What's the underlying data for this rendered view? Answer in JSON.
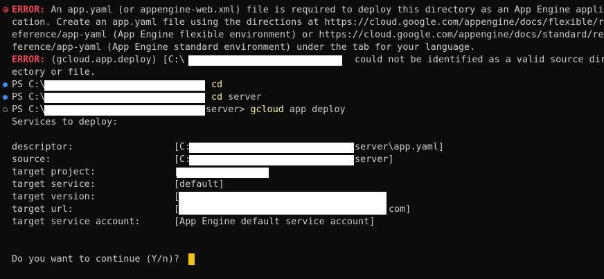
{
  "error1": {
    "label": "ERROR:",
    "lines": [
      " An app.yaml (or appengine-web.xml) file is required to deploy this directory as an App Engine appli",
      "cation. Create an app.yaml file using the directions at https://cloud.google.com/appengine/docs/flexible/r",
      "eference/app-yaml (App Engine flexible environment) or https://cloud.google.com/appengine/docs/standard/re",
      "ference/app-yaml (App Engine standard environment) under the tab for your language."
    ]
  },
  "error2": {
    "label": "ERROR:",
    "prefix": " (gcloud.app.deploy) [C:\\",
    "suffix": " could not be identified as a valid source dir",
    "line2": "ectory or file."
  },
  "prompts": [
    {
      "prefix": "PS C:\\",
      "command": "cd",
      "args": ""
    },
    {
      "prefix": "PS C:\\",
      "command": "cd",
      "args": " server"
    },
    {
      "prefix": "PS C:\\",
      "path_tail": "server> ",
      "command": "gcloud",
      "args": " app deploy"
    }
  ],
  "services_header": "Services to deploy:",
  "details": {
    "descriptor": {
      "label": "descriptor:",
      "value_start": "[C:\\",
      "value_end": "server\\app.yaml]"
    },
    "source": {
      "label": "source:",
      "value_start": "[C:\\",
      "value_end": "server]"
    },
    "target_project": {
      "label": "target project:",
      "value_start": "[",
      "value_end": ""
    },
    "target_service": {
      "label": "target service:",
      "value": "[default]"
    },
    "target_version": {
      "label": "target version:",
      "value_start": "[",
      "value_end": ""
    },
    "target_url": {
      "label": "target url:",
      "value_start": "[",
      "value_end": "com]"
    },
    "target_service_account": {
      "label": "target service account:",
      "value": "[App Engine default service account]"
    }
  },
  "confirm_prompt": "Do you want to continue (Y/n)?",
  "colors": {
    "background": "#0c0c0c",
    "text": "#cccccc",
    "error": "#e74856",
    "command": "#f9f1a5",
    "cursor": "#f1c40f",
    "redaction": "#ffffff"
  }
}
